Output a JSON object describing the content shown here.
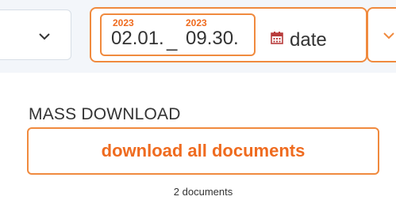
{
  "filters": {
    "date_range": {
      "start_year": "2023",
      "start_value": "02.01.",
      "separator": "_",
      "end_year": "2023",
      "end_value": "09.30."
    },
    "date_field_label": "date"
  },
  "mass_download": {
    "title": "MASS DOWNLOAD",
    "button_label": "download all documents",
    "document_count_text": "2 documents"
  },
  "colors": {
    "accent": "#f08a3e",
    "accent_text": "#ef6b1f",
    "topbar_bg": "#f3f6fa"
  },
  "icons": [
    "chevron-down-icon",
    "calendar-icon"
  ]
}
